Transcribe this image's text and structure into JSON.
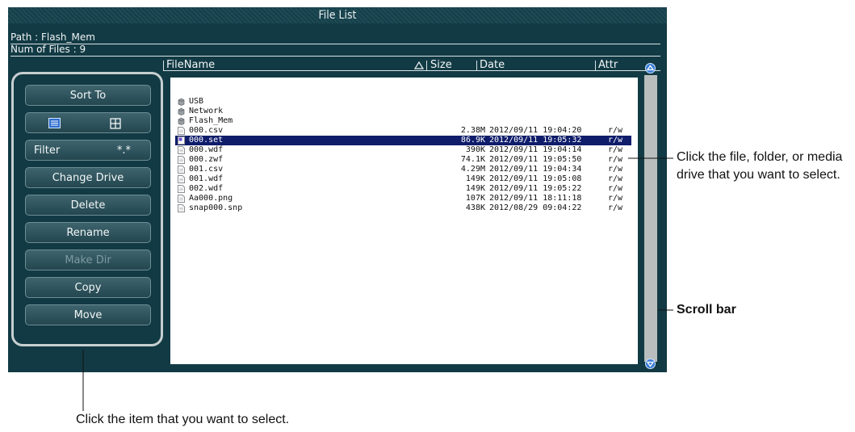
{
  "window": {
    "title": "File List"
  },
  "info": {
    "path": "Path : Flash_Mem",
    "num_files": "Num of Files : 9"
  },
  "columns": {
    "filename": "FileName",
    "size": "Size",
    "date": "Date",
    "attr": "Attr"
  },
  "side_buttons": {
    "sort_to": "Sort To",
    "list_view_icon": "list-icon",
    "thumbnail_view_icon": "grid-icon",
    "filter": "Filter",
    "filter_value": "*.*",
    "change_drive": "Change Drive",
    "delete": "Delete",
    "rename": "Rename",
    "make_dir": "Make Dir",
    "copy": "Copy",
    "move": "Move"
  },
  "entries": [
    {
      "name": "USB",
      "type": "drive",
      "size": "",
      "date": "",
      "attr": ""
    },
    {
      "name": "Network",
      "type": "drive",
      "size": "",
      "date": "",
      "attr": ""
    },
    {
      "name": "Flash_Mem",
      "type": "drive",
      "size": "",
      "date": "",
      "attr": ""
    },
    {
      "name": "000.csv",
      "type": "file",
      "size": "2.38M",
      "date": "2012/09/11 19:04:20",
      "attr": "r/w"
    },
    {
      "name": "000.set",
      "type": "file",
      "size": "86.9K",
      "date": "2012/09/11 19:05:32",
      "attr": "r/w",
      "selected": true
    },
    {
      "name": "000.wdf",
      "type": "file",
      "size": "390K",
      "date": "2012/09/11 19:04:14",
      "attr": "r/w"
    },
    {
      "name": "000.zwf",
      "type": "file",
      "size": "74.1K",
      "date": "2012/09/11 19:05:50",
      "attr": "r/w"
    },
    {
      "name": "001.csv",
      "type": "file",
      "size": "4.29M",
      "date": "2012/09/11 19:04:34",
      "attr": "r/w"
    },
    {
      "name": "001.wdf",
      "type": "file",
      "size": "149K",
      "date": "2012/09/11 19:05:08",
      "attr": "r/w"
    },
    {
      "name": "002.wdf",
      "type": "file",
      "size": "149K",
      "date": "2012/09/11 19:05:22",
      "attr": "r/w"
    },
    {
      "name": "Aa000.png",
      "type": "file",
      "size": "107K",
      "date": "2012/09/11 18:11:18",
      "attr": "r/w"
    },
    {
      "name": "snap000.snp",
      "type": "file",
      "size": "438K",
      "date": "2012/08/29 09:04:22",
      "attr": "r/w"
    }
  ],
  "annotations": {
    "select_file": "Click the file, folder, or media drive that you want to select.",
    "scroll_bar": "Scroll bar",
    "select_item": "Click the item that you want to select."
  },
  "colors": {
    "screen_bg": "#123a44",
    "selection": "#0f1d6b",
    "scroll_button": "#3b7fd8"
  }
}
